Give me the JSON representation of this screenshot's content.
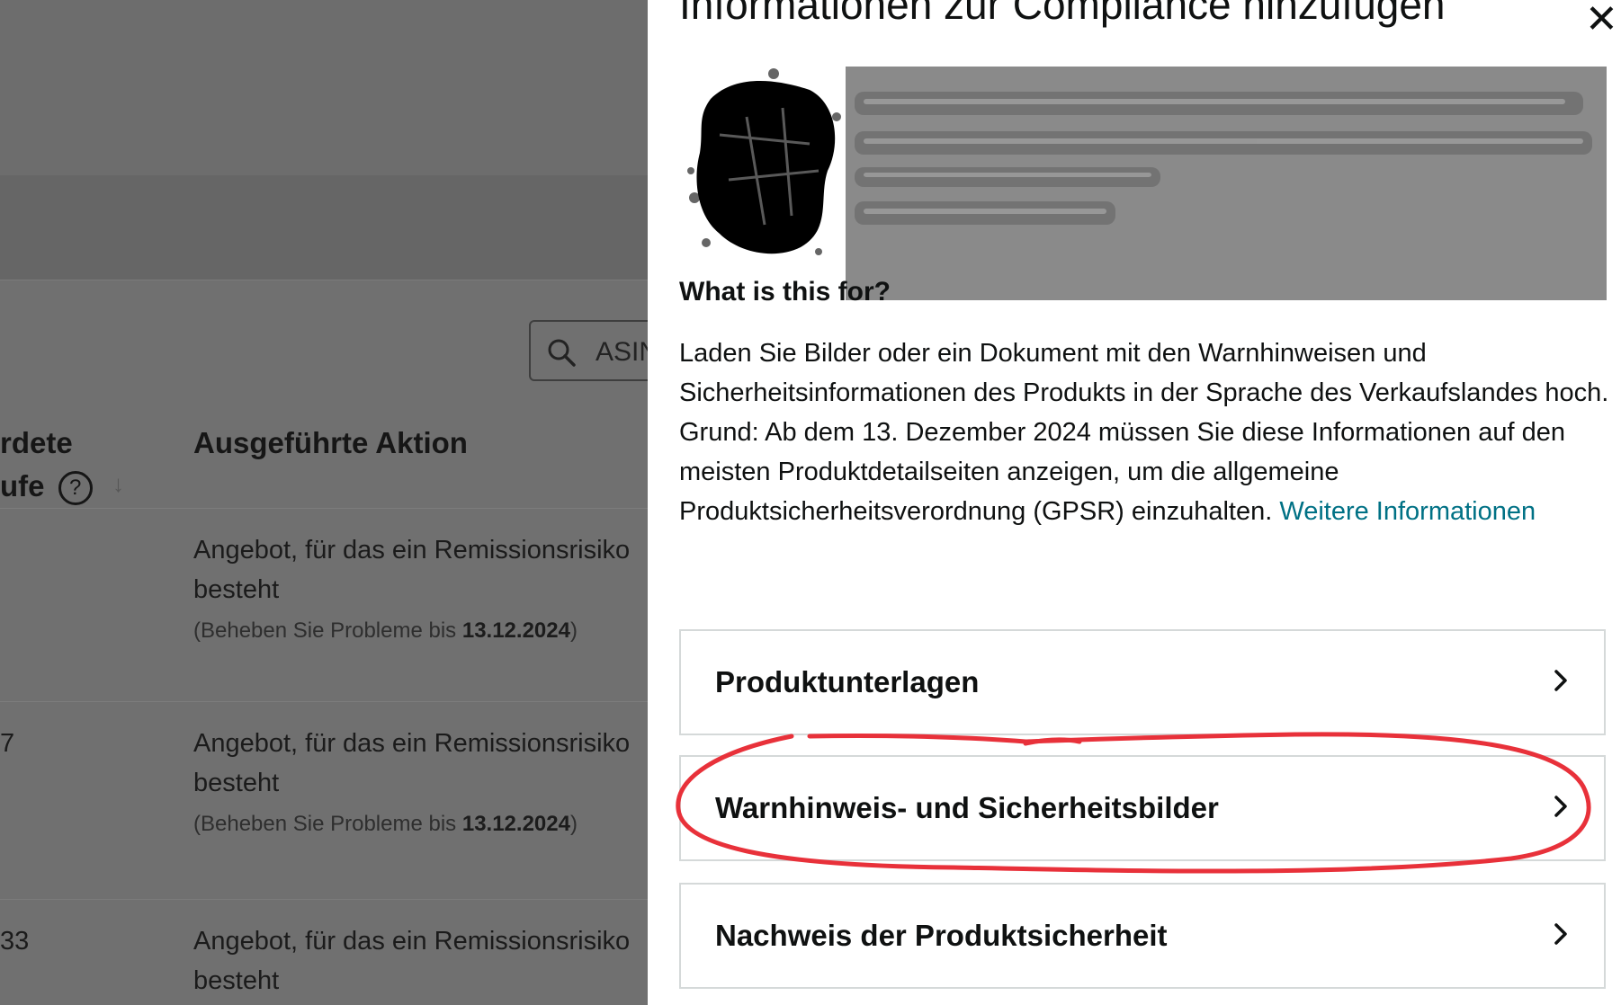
{
  "background_page": {
    "search_placeholder": "ASIN",
    "columns": {
      "col1_line1": "rdete",
      "col1_line2": "ufe",
      "help_symbol": "?",
      "sort_arrow": "↓",
      "action": "Ausgeführte Aktion"
    },
    "rows": [
      {
        "prefix": "",
        "action_line1": "Angebot, für das ein Remissionsrisiko",
        "action_line2": "besteht",
        "due_prefix": "(Beheben Sie Probleme bis ",
        "due_date": "13.12.2024",
        "due_suffix": ")"
      },
      {
        "prefix": "7",
        "action_line1": "Angebot, für das ein Remissionsrisiko",
        "action_line2": "besteht",
        "due_prefix": "(Beheben Sie Probleme bis ",
        "due_date": "13.12.2024",
        "due_suffix": ")"
      },
      {
        "prefix": "33",
        "action_line1": "Angebot, für das ein Remissionsrisiko",
        "action_line2": "besteht"
      }
    ]
  },
  "panel": {
    "title": "Informationen zur Compliance hinzufügen",
    "close_symbol": "✕",
    "what_heading": "What is this for?",
    "desc_line1": "Laden Sie Bilder oder ein Dokument mit den Warnhinweisen und Sicherheitsinformationen des Produkts in der Sprache des Verkaufslandes hoch.",
    "desc_line2": "Grund: Ab dem 13. Dezember 2024 müssen Sie diese Informationen auf den meisten Produktdetailseiten anzeigen, um die allgemeine Produktsicherheitsverordnung (GPSR) einzuhalten. ",
    "more_link": "Weitere Informationen",
    "sections": [
      {
        "label": "Produktunterlagen"
      },
      {
        "label": "Warnhinweis- und Sicherheitsbilder"
      },
      {
        "label": "Nachweis der Produktsicherheit"
      }
    ]
  },
  "colors": {
    "link": "#007185",
    "annotation": "#e8313a",
    "overlay": "#707070"
  }
}
